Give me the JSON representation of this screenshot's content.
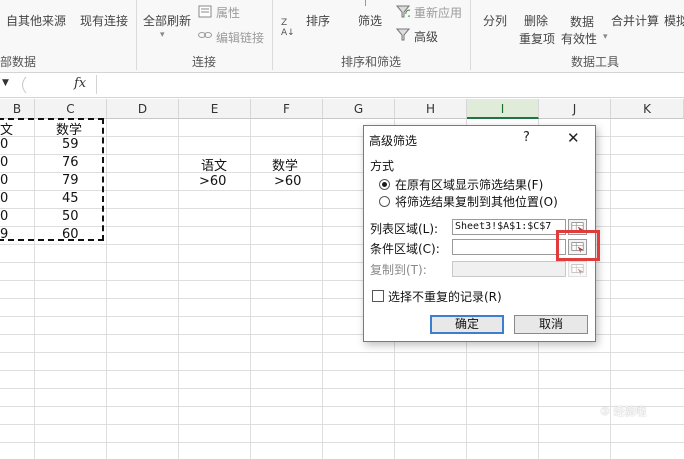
{
  "ribbon": {
    "buttons": {
      "from_other_sources": "自其他来源",
      "existing_connections": "现有连接",
      "refresh_all": "全部刷新",
      "properties": "属性",
      "edit_links": "编辑链接",
      "sort": "排序",
      "filter": "筛选",
      "reapply": "重新应用",
      "advanced": "高级",
      "text_to_columns": "分列",
      "remove_duplicates_1": "删除",
      "remove_duplicates_2": "重复项",
      "data_validation_1": "数据",
      "data_validation_2": "有效性",
      "consolidate": "合并计算",
      "what_if": "模拟"
    },
    "groups": {
      "get_external": "部数据",
      "connections": "连接",
      "sort_filter": "排序和筛选",
      "data_tools": "数据工具"
    }
  },
  "formula_bar": {
    "fx": "fx",
    "value": ""
  },
  "sheet": {
    "columns": [
      "B",
      "C",
      "D",
      "E",
      "F",
      "G",
      "H",
      "I",
      "J",
      "K"
    ],
    "selected_column": "I",
    "col_b": [
      "文",
      "0",
      "0",
      "0",
      "0",
      "0",
      "9"
    ],
    "col_c": [
      "数学",
      "59",
      "76",
      "79",
      "45",
      "50",
      "60"
    ],
    "criteria": {
      "e_header": "语文",
      "f_header": "数学",
      "e_value": ">60",
      "f_value": ">60"
    }
  },
  "dialog": {
    "title": "高级筛选",
    "help": "?",
    "close": "✕",
    "method_label": "方式",
    "radio_in_place": "在原有区域显示筛选结果(F)",
    "radio_copy": "将筛选结果复制到其他位置(O)",
    "list_range_label": "列表区域(L):",
    "list_range_value": "Sheet3!$A$1:$C$7",
    "criteria_range_label": "条件区域(C):",
    "criteria_range_value": "",
    "copy_to_label": "复制到(T):",
    "copy_to_value": "",
    "unique_label": "选择不重复的记录(R)",
    "ok": "确定",
    "cancel": "取消"
  },
  "watermark": "⑤ 经验啦"
}
